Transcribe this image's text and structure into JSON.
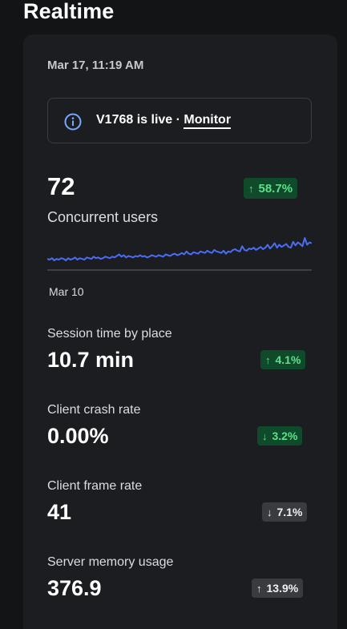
{
  "page": {
    "title": "Realtime"
  },
  "panel": {
    "timestamp": "Mar 17, 11:19 AM",
    "banner": {
      "icon": "info-icon",
      "text": "V1768 is live · ",
      "link": "Monitor"
    },
    "concurrent": {
      "value": "72",
      "label": "Concurrent users",
      "change": "58.7%",
      "direction": "up",
      "axis_start_label": "Mar 10"
    },
    "metrics": [
      {
        "label": "Session time by place",
        "value": "10.7 min",
        "change": "4.1%",
        "direction": "up",
        "tone": "green"
      },
      {
        "label": "Client crash rate",
        "value": "0.00%",
        "change": "3.2%",
        "direction": "down",
        "tone": "green"
      },
      {
        "label": "Client frame rate",
        "value": "41",
        "change": "7.1%",
        "direction": "down",
        "tone": "gray"
      },
      {
        "label": "Server memory usage",
        "value": "376.9",
        "change": "13.9%",
        "direction": "up",
        "tone": "gray"
      }
    ]
  },
  "colors": {
    "background": "#131416",
    "panel": "#1c1d21",
    "sparkline": "#4a6cf7",
    "positive_badge_bg": "#0f4a2a",
    "positive_badge_text": "#5ee08b",
    "neutral_badge_bg": "#3a3b40",
    "info_icon": "#7aa7ff"
  },
  "sparkline_values": [
    14,
    13,
    15,
    12,
    14,
    13,
    15,
    14,
    12,
    15,
    13,
    14,
    16,
    13,
    15,
    14,
    13,
    16,
    15,
    14,
    17,
    15,
    16,
    14,
    15,
    17,
    16,
    15,
    17,
    16,
    18,
    20,
    17,
    19,
    16,
    18,
    17,
    16,
    18,
    17,
    19,
    17,
    18,
    16,
    17,
    19,
    18,
    17,
    19,
    18,
    17,
    20,
    19,
    18,
    20,
    21,
    19,
    20,
    22,
    20,
    24,
    21,
    20,
    23,
    22,
    21,
    24,
    23,
    22,
    25,
    23,
    22,
    26,
    24,
    23,
    22,
    25,
    21,
    24,
    23,
    26,
    27,
    25,
    24,
    31,
    26,
    25,
    28,
    27,
    29,
    26,
    28,
    30,
    27,
    29,
    33,
    28,
    31,
    35,
    29,
    33,
    30,
    32,
    34,
    30,
    29,
    37,
    32,
    36,
    34,
    31,
    42,
    33,
    36,
    35
  ]
}
